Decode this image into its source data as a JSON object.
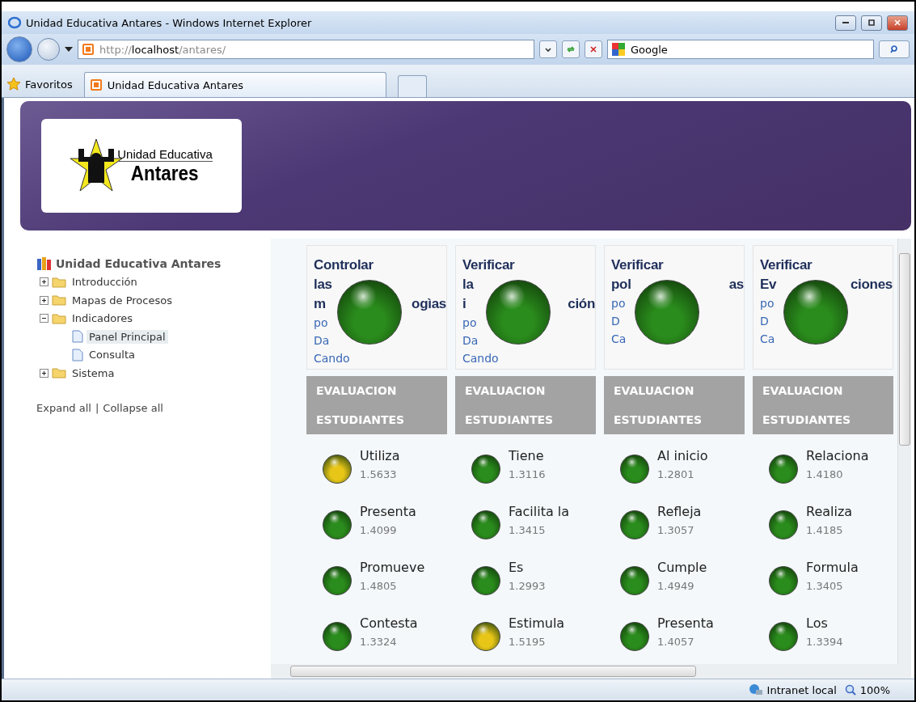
{
  "window": {
    "title": "Unidad Educativa Antares - Windows Internet Explorer"
  },
  "address_bar": {
    "value_prefix": "http://",
    "value_host": "localhost",
    "value_path": "/antares/"
  },
  "search": {
    "value": "Google"
  },
  "favorites": {
    "label": "Favoritos"
  },
  "tabs": [
    {
      "label": "Unidad Educativa Antares",
      "selected": true
    }
  ],
  "logo": {
    "line1": "Unidad Educativa",
    "line2": "Antares"
  },
  "tree": {
    "label": "Unidad Educativa Antares",
    "children": [
      {
        "label": "Introducción",
        "kind": "folder",
        "expanded": false,
        "selected": false
      },
      {
        "label": "Mapas de Procesos",
        "kind": "folder",
        "expanded": false,
        "selected": false
      },
      {
        "label": "Indicadores",
        "kind": "folder",
        "expanded": true,
        "selected": false,
        "children": [
          {
            "label": "Panel Principal",
            "kind": "page",
            "selected": true
          },
          {
            "label": "Consulta",
            "kind": "page",
            "selected": false
          }
        ]
      },
      {
        "label": "Sistema",
        "kind": "folder",
        "expanded": false,
        "selected": false
      }
    ]
  },
  "tree_links": [
    "Expand all",
    "Collapse all"
  ],
  "tree_link_separator": "|",
  "cards": [
    {
      "title_lines": [
        [
          "Controlar"
        ],
        [
          "las"
        ],
        [
          "m",
          "ogìas"
        ]
      ],
      "sub_lines": [
        "po",
        "Da",
        "Cando"
      ],
      "color": "#2a8c1c",
      "header": "EVALUACION ESTUDIANTES",
      "items": [
        {
          "name": "Utiliza",
          "value": "1.5633",
          "color": "#e8c617"
        },
        {
          "name": "Presenta",
          "value": "1.4099",
          "color": "#2a8c1c"
        },
        {
          "name": "Promueve",
          "value": "1.4805",
          "color": "#2a8c1c"
        },
        {
          "name": "Contesta",
          "value": "1.3324",
          "color": "#2a8c1c"
        }
      ]
    },
    {
      "title_lines": [
        [
          "Verificar"
        ],
        [
          "la"
        ],
        [
          "i",
          "ción"
        ]
      ],
      "sub_lines": [
        "po",
        "Da",
        "Cando"
      ],
      "color": "#2a8c1c",
      "header": "EVALUACION ESTUDIANTES",
      "items": [
        {
          "name": "Tiene",
          "value": "1.3116",
          "color": "#2a8c1c"
        },
        {
          "name": "Facilita la",
          "value": "1.3415",
          "color": "#2a8c1c"
        },
        {
          "name": "Es",
          "value": "1.2993",
          "color": "#2a8c1c"
        },
        {
          "name": "Estimula",
          "value": "1.5195",
          "color": "#e8c617"
        }
      ]
    },
    {
      "title_lines": [
        [
          "Verificar"
        ],
        [
          "pol",
          "as"
        ]
      ],
      "sub_lines": [
        "po",
        "D",
        "Ca"
      ],
      "color": "#2a8c1c",
      "header": "EVALUACION ESTUDIANTES",
      "items": [
        {
          "name": "Al inicio",
          "value": "1.2801",
          "color": "#2a8c1c"
        },
        {
          "name": "Refleja",
          "value": "1.3057",
          "color": "#2a8c1c"
        },
        {
          "name": "Cumple",
          "value": "1.4949",
          "color": "#2a8c1c"
        },
        {
          "name": "Presenta",
          "value": "1.4057",
          "color": "#2a8c1c"
        }
      ]
    },
    {
      "title_lines": [
        [
          "Verificar"
        ],
        [
          "Ev",
          "ciones"
        ]
      ],
      "sub_lines": [
        "po",
        "D",
        "Ca"
      ],
      "color": "#2a8c1c",
      "header": "EVALUACION ESTUDIANTES",
      "items": [
        {
          "name": "Relaciona",
          "value": "1.4180",
          "color": "#2a8c1c"
        },
        {
          "name": "Realiza",
          "value": "1.4185",
          "color": "#2a8c1c"
        },
        {
          "name": "Formula",
          "value": "1.3405",
          "color": "#2a8c1c"
        },
        {
          "name": "Los",
          "value": "1.3394",
          "color": "#2a8c1c"
        }
      ]
    }
  ],
  "status_bar": {
    "zone": "Intranet local",
    "zoom": "100%"
  }
}
